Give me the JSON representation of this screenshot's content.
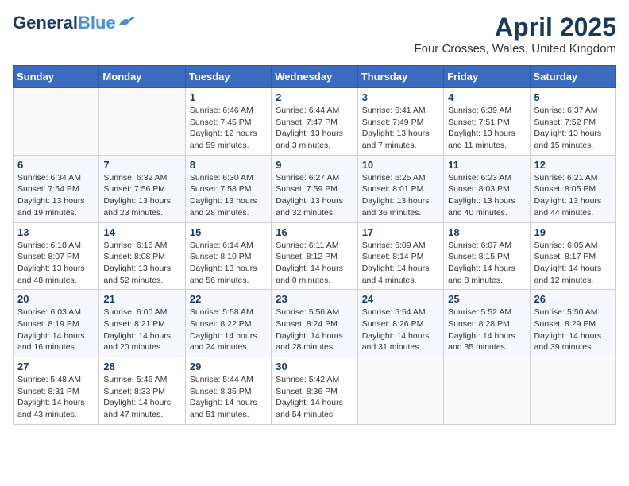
{
  "header": {
    "logo_general": "General",
    "logo_blue": "Blue",
    "title": "April 2025",
    "subtitle": "Four Crosses, Wales, United Kingdom"
  },
  "weekdays": [
    "Sunday",
    "Monday",
    "Tuesday",
    "Wednesday",
    "Thursday",
    "Friday",
    "Saturday"
  ],
  "weeks": [
    [
      {
        "day": "",
        "info": ""
      },
      {
        "day": "",
        "info": ""
      },
      {
        "day": "1",
        "info": "Sunrise: 6:46 AM\nSunset: 7:45 PM\nDaylight: 12 hours and 59 minutes."
      },
      {
        "day": "2",
        "info": "Sunrise: 6:44 AM\nSunset: 7:47 PM\nDaylight: 13 hours and 3 minutes."
      },
      {
        "day": "3",
        "info": "Sunrise: 6:41 AM\nSunset: 7:49 PM\nDaylight: 13 hours and 7 minutes."
      },
      {
        "day": "4",
        "info": "Sunrise: 6:39 AM\nSunset: 7:51 PM\nDaylight: 13 hours and 11 minutes."
      },
      {
        "day": "5",
        "info": "Sunrise: 6:37 AM\nSunset: 7:52 PM\nDaylight: 13 hours and 15 minutes."
      }
    ],
    [
      {
        "day": "6",
        "info": "Sunrise: 6:34 AM\nSunset: 7:54 PM\nDaylight: 13 hours and 19 minutes."
      },
      {
        "day": "7",
        "info": "Sunrise: 6:32 AM\nSunset: 7:56 PM\nDaylight: 13 hours and 23 minutes."
      },
      {
        "day": "8",
        "info": "Sunrise: 6:30 AM\nSunset: 7:58 PM\nDaylight: 13 hours and 28 minutes."
      },
      {
        "day": "9",
        "info": "Sunrise: 6:27 AM\nSunset: 7:59 PM\nDaylight: 13 hours and 32 minutes."
      },
      {
        "day": "10",
        "info": "Sunrise: 6:25 AM\nSunset: 8:01 PM\nDaylight: 13 hours and 36 minutes."
      },
      {
        "day": "11",
        "info": "Sunrise: 6:23 AM\nSunset: 8:03 PM\nDaylight: 13 hours and 40 minutes."
      },
      {
        "day": "12",
        "info": "Sunrise: 6:21 AM\nSunset: 8:05 PM\nDaylight: 13 hours and 44 minutes."
      }
    ],
    [
      {
        "day": "13",
        "info": "Sunrise: 6:18 AM\nSunset: 8:07 PM\nDaylight: 13 hours and 48 minutes."
      },
      {
        "day": "14",
        "info": "Sunrise: 6:16 AM\nSunset: 8:08 PM\nDaylight: 13 hours and 52 minutes."
      },
      {
        "day": "15",
        "info": "Sunrise: 6:14 AM\nSunset: 8:10 PM\nDaylight: 13 hours and 56 minutes."
      },
      {
        "day": "16",
        "info": "Sunrise: 6:11 AM\nSunset: 8:12 PM\nDaylight: 14 hours and 0 minutes."
      },
      {
        "day": "17",
        "info": "Sunrise: 6:09 AM\nSunset: 8:14 PM\nDaylight: 14 hours and 4 minutes."
      },
      {
        "day": "18",
        "info": "Sunrise: 6:07 AM\nSunset: 8:15 PM\nDaylight: 14 hours and 8 minutes."
      },
      {
        "day": "19",
        "info": "Sunrise: 6:05 AM\nSunset: 8:17 PM\nDaylight: 14 hours and 12 minutes."
      }
    ],
    [
      {
        "day": "20",
        "info": "Sunrise: 6:03 AM\nSunset: 8:19 PM\nDaylight: 14 hours and 16 minutes."
      },
      {
        "day": "21",
        "info": "Sunrise: 6:00 AM\nSunset: 8:21 PM\nDaylight: 14 hours and 20 minutes."
      },
      {
        "day": "22",
        "info": "Sunrise: 5:58 AM\nSunset: 8:22 PM\nDaylight: 14 hours and 24 minutes."
      },
      {
        "day": "23",
        "info": "Sunrise: 5:56 AM\nSunset: 8:24 PM\nDaylight: 14 hours and 28 minutes."
      },
      {
        "day": "24",
        "info": "Sunrise: 5:54 AM\nSunset: 8:26 PM\nDaylight: 14 hours and 31 minutes."
      },
      {
        "day": "25",
        "info": "Sunrise: 5:52 AM\nSunset: 8:28 PM\nDaylight: 14 hours and 35 minutes."
      },
      {
        "day": "26",
        "info": "Sunrise: 5:50 AM\nSunset: 8:29 PM\nDaylight: 14 hours and 39 minutes."
      }
    ],
    [
      {
        "day": "27",
        "info": "Sunrise: 5:48 AM\nSunset: 8:31 PM\nDaylight: 14 hours and 43 minutes."
      },
      {
        "day": "28",
        "info": "Sunrise: 5:46 AM\nSunset: 8:33 PM\nDaylight: 14 hours and 47 minutes."
      },
      {
        "day": "29",
        "info": "Sunrise: 5:44 AM\nSunset: 8:35 PM\nDaylight: 14 hours and 51 minutes."
      },
      {
        "day": "30",
        "info": "Sunrise: 5:42 AM\nSunset: 8:36 PM\nDaylight: 14 hours and 54 minutes."
      },
      {
        "day": "",
        "info": ""
      },
      {
        "day": "",
        "info": ""
      },
      {
        "day": "",
        "info": ""
      }
    ]
  ]
}
